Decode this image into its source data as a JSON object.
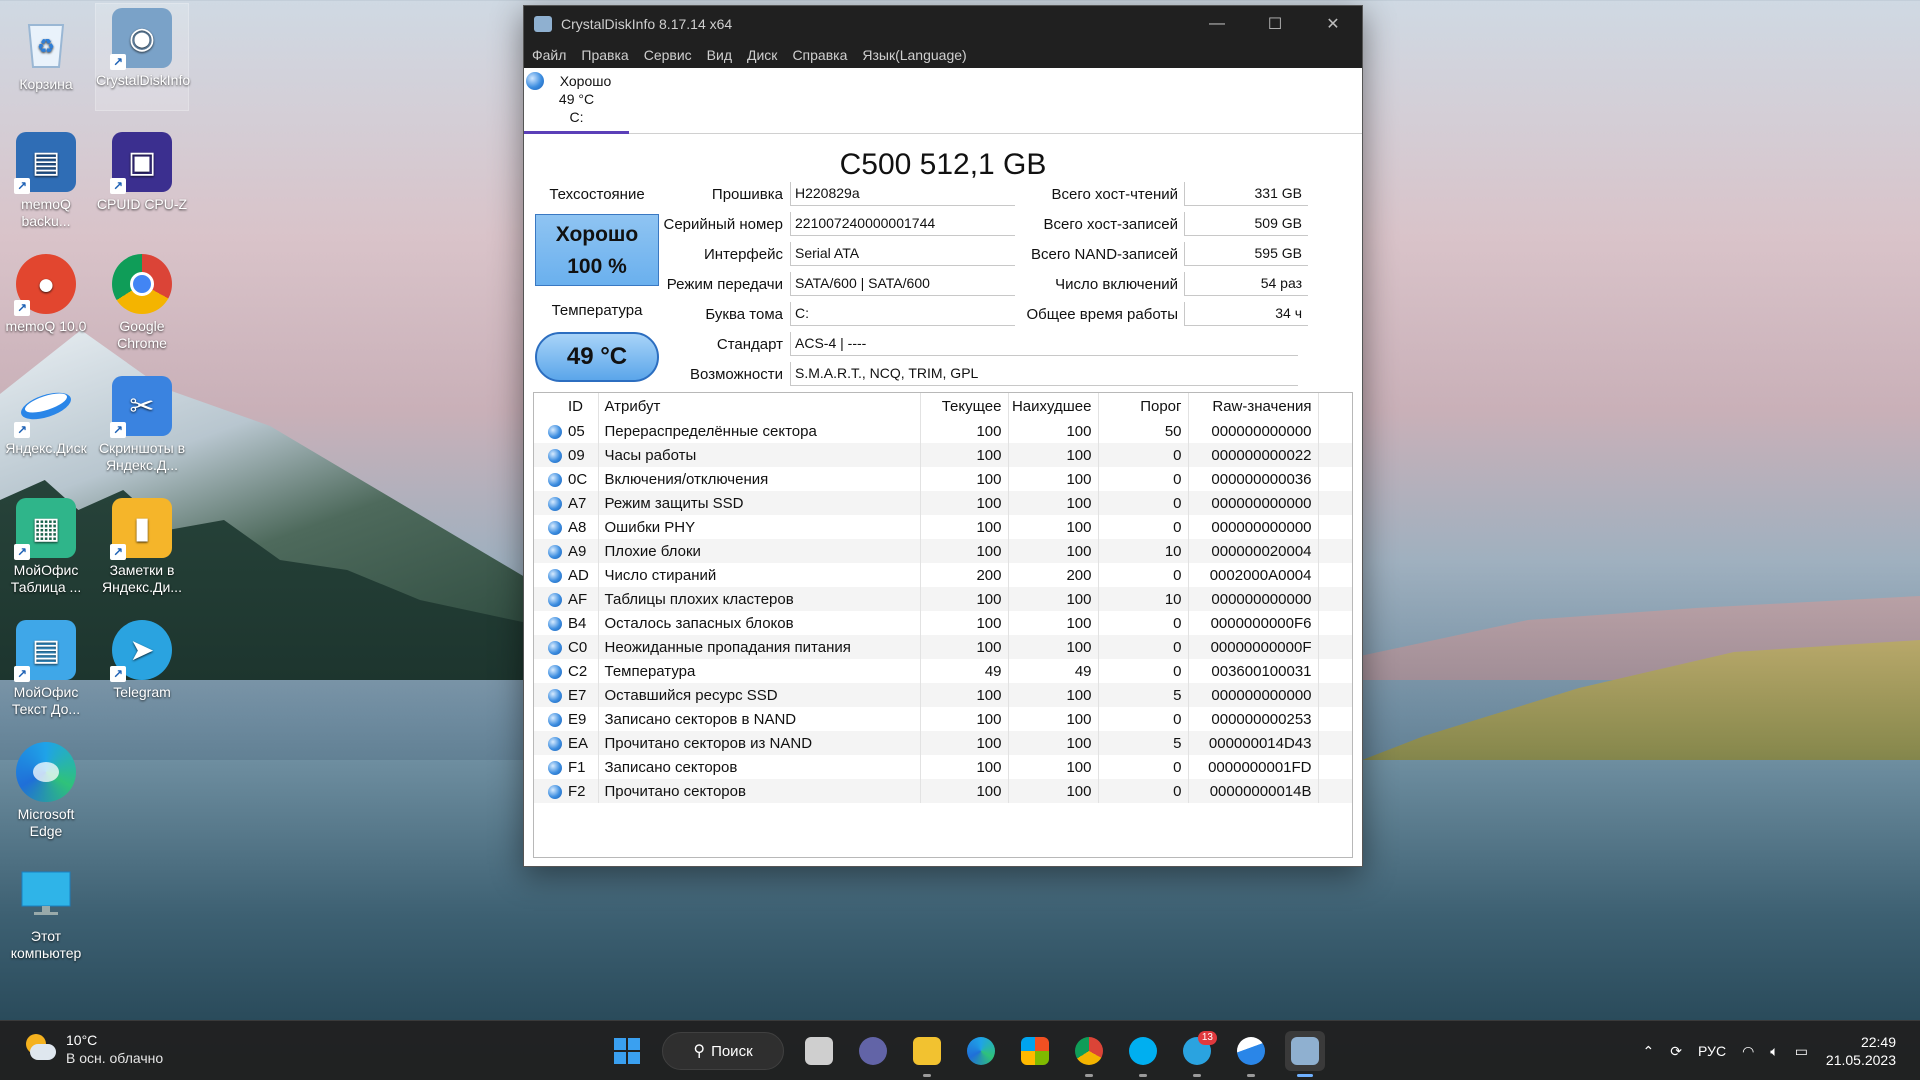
{
  "desktop": {
    "icons": [
      {
        "label": "Корзина"
      },
      {
        "label": "CrystalDiskInfo"
      },
      {
        "label": "memoQ backu..."
      },
      {
        "label": "CPUID CPU-Z"
      },
      {
        "label": "memoQ 10.0"
      },
      {
        "label": "Google Chrome"
      },
      {
        "label": "Яндекс.Диск"
      },
      {
        "label": "Скриншоты в Яндекс.Д..."
      },
      {
        "label": "МойОфис Таблица ..."
      },
      {
        "label": "Заметки в Яндекс.Ди..."
      },
      {
        "label": "МойОфис Текст До..."
      },
      {
        "label": "Telegram"
      },
      {
        "label": "Microsoft Edge"
      },
      {
        "label": "Этот компьютер"
      }
    ]
  },
  "window": {
    "title": "CrystalDiskInfo 8.17.14 x64",
    "minimize_glyph": "—",
    "maximize_glyph": "☐",
    "close_glyph": "✕"
  },
  "menu": [
    "Файл",
    "Правка",
    "Сервис",
    "Вид",
    "Диск",
    "Справка",
    "Язык(Language)"
  ],
  "disk_tab": {
    "status": "Хорошо",
    "temp": "49 °C",
    "letter": "C:"
  },
  "disk": {
    "model": "C500 512,1 GB",
    "health_label": "Техсостояние",
    "health_status": "Хорошо",
    "health_percent": "100 %",
    "temp_label": "Температура",
    "temp_value": "49 °C",
    "info": [
      {
        "key": "Прошивка",
        "value": "H220829a"
      },
      {
        "key": "Серийный номер",
        "value": "221007240000001744"
      },
      {
        "key": "Интерфейс",
        "value": "Serial ATA"
      },
      {
        "key": "Режим передачи",
        "value": "SATA/600 | SATA/600"
      },
      {
        "key": "Буква тома",
        "value": "C:"
      },
      {
        "key": "Стандарт",
        "value": "ACS-4 | ----"
      },
      {
        "key": "Возможности",
        "value": "S.M.A.R.T., NCQ, TRIM, GPL"
      }
    ],
    "right_info": [
      {
        "key": "Всего хост-чтений",
        "value": "331 GB"
      },
      {
        "key": "Всего хост-записей",
        "value": "509 GB"
      },
      {
        "key": "Всего NAND-записей",
        "value": "595 GB"
      },
      {
        "key": "Число включений",
        "value": "54 раз"
      },
      {
        "key": "Общее время работы",
        "value": "34 ч"
      }
    ]
  },
  "smart": {
    "headers": [
      "ID",
      "Атрибут",
      "Текущее",
      "Наихудшее",
      "Порог",
      "Raw-значения"
    ],
    "rows": [
      [
        "05",
        "Перераспределённые сектора",
        "100",
        "100",
        "50",
        "000000000000"
      ],
      [
        "09",
        "Часы работы",
        "100",
        "100",
        "0",
        "000000000022"
      ],
      [
        "0C",
        "Включения/отключения",
        "100",
        "100",
        "0",
        "000000000036"
      ],
      [
        "A7",
        "Режим защиты SSD",
        "100",
        "100",
        "0",
        "000000000000"
      ],
      [
        "A8",
        "Ошибки PHY",
        "100",
        "100",
        "0",
        "000000000000"
      ],
      [
        "A9",
        "Плохие блоки",
        "100",
        "100",
        "10",
        "000000020004"
      ],
      [
        "AD",
        "Число стираний",
        "200",
        "200",
        "0",
        "0002000A0004"
      ],
      [
        "AF",
        "Таблицы плохих кластеров",
        "100",
        "100",
        "10",
        "000000000000"
      ],
      [
        "B4",
        "Осталось запасных блоков",
        "100",
        "100",
        "0",
        "0000000000F6"
      ],
      [
        "C0",
        "Неожиданные пропадания питания",
        "100",
        "100",
        "0",
        "00000000000F"
      ],
      [
        "C2",
        "Температура",
        "49",
        "49",
        "0",
        "003600100031"
      ],
      [
        "E7",
        "Оставшийся ресурс SSD",
        "100",
        "100",
        "5",
        "000000000000"
      ],
      [
        "E9",
        "Записано секторов в NAND",
        "100",
        "100",
        "0",
        "000000000253"
      ],
      [
        "EA",
        "Прочитано секторов из NAND",
        "100",
        "100",
        "5",
        "000000014D43"
      ],
      [
        "F1",
        "Записано секторов",
        "100",
        "100",
        "0",
        "0000000001FD"
      ],
      [
        "F2",
        "Прочитано секторов",
        "100",
        "100",
        "0",
        "00000000014B"
      ]
    ]
  },
  "taskbar": {
    "weather_temp": "10°C",
    "weather_desc": "В осн. облачно",
    "search_label": "Поиск",
    "telegram_badge": "13",
    "lang": "РУС",
    "time": "22:49",
    "date": "21.05.2023"
  },
  "colors": {
    "health_good": "#6ab0ee",
    "titlebar": "#202020",
    "status_dot": "#3c8de0"
  }
}
